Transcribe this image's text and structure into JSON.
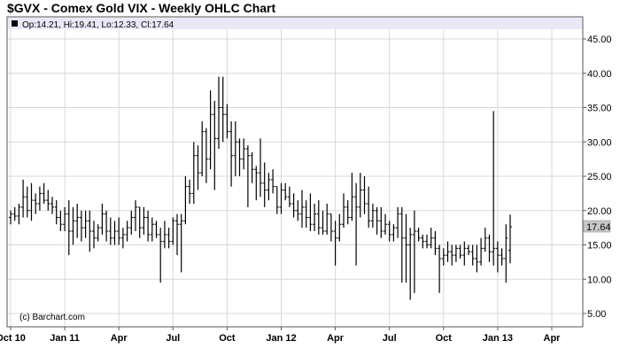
{
  "chart_data": {
    "type": "ohlc",
    "title": "$GVX - Comex Gold VIX - Weekly OHLC Chart",
    "legend": "Op:14.21, Hi:19.41, Lo:12.33, Cl:17.64",
    "credit": "(c) Barchart.com",
    "last_price_label": "17.64",
    "colors": {
      "bar": "#000000",
      "legend_bg": "#e8e8f7",
      "grid": "#d8d8d8",
      "last_price_box": "#c8c8c8"
    },
    "y_ticks": [
      "45.00",
      "40.00",
      "35.00",
      "30.00",
      "25.00",
      "20.00",
      "15.00",
      "10.00",
      "5.00"
    ],
    "ylim": [
      3,
      48
    ],
    "x_ticks": [
      {
        "label": "Oct 10",
        "week": 0
      },
      {
        "label": "Jan 11",
        "week": 13
      },
      {
        "label": "Apr",
        "week": 26
      },
      {
        "label": "Jul",
        "week": 39
      },
      {
        "label": "Oct",
        "week": 52
      },
      {
        "label": "Jan 12",
        "week": 65
      },
      {
        "label": "Apr",
        "week": 78
      },
      {
        "label": "Jul",
        "week": 91
      },
      {
        "label": "Oct",
        "week": 104
      },
      {
        "label": "Jan 13",
        "week": 117
      },
      {
        "label": "Apr",
        "week": 130
      }
    ],
    "bars": [
      [
        19.0,
        20.0,
        18.0,
        19.5
      ],
      [
        19.5,
        20.5,
        18.5,
        19.2
      ],
      [
        19.2,
        21.0,
        18.0,
        20.5
      ],
      [
        20.5,
        24.5,
        19.0,
        22.0
      ],
      [
        22.0,
        23.5,
        19.0,
        20.0
      ],
      [
        20.0,
        24.0,
        18.5,
        21.5
      ],
      [
        21.5,
        22.5,
        19.5,
        21.0
      ],
      [
        21.0,
        23.5,
        20.0,
        22.5
      ],
      [
        22.5,
        24.0,
        21.0,
        21.5
      ],
      [
        21.5,
        23.0,
        20.0,
        21.0
      ],
      [
        21.0,
        22.0,
        19.5,
        20.5
      ],
      [
        20.5,
        21.5,
        18.0,
        19.0
      ],
      [
        19.0,
        20.0,
        17.0,
        18.0
      ],
      [
        18.0,
        20.5,
        17.0,
        19.5
      ],
      [
        19.5,
        21.5,
        13.5,
        17.0
      ],
      [
        17.0,
        20.5,
        15.0,
        18.5
      ],
      [
        18.5,
        21.0,
        16.0,
        19.0
      ],
      [
        19.0,
        20.0,
        15.5,
        17.5
      ],
      [
        17.5,
        20.0,
        16.0,
        18.5
      ],
      [
        18.5,
        20.0,
        14.0,
        17.0
      ],
      [
        17.0,
        18.5,
        14.5,
        16.0
      ],
      [
        16.0,
        18.0,
        15.5,
        17.5
      ],
      [
        17.5,
        21.0,
        16.5,
        19.5
      ],
      [
        19.5,
        20.0,
        15.5,
        17.0
      ],
      [
        17.0,
        19.0,
        15.0,
        16.0
      ],
      [
        16.0,
        18.5,
        15.0,
        17.0
      ],
      [
        17.0,
        19.0,
        15.0,
        16.0
      ],
      [
        16.0,
        17.5,
        14.5,
        16.5
      ],
      [
        16.5,
        18.5,
        15.5,
        17.5
      ],
      [
        17.5,
        20.0,
        16.5,
        19.0
      ],
      [
        19.0,
        21.5,
        17.0,
        20.5
      ],
      [
        20.5,
        20.5,
        16.0,
        17.5
      ],
      [
        17.5,
        20.5,
        16.5,
        19.0
      ],
      [
        19.0,
        20.0,
        15.5,
        16.5
      ],
      [
        16.5,
        19.0,
        15.5,
        18.0
      ],
      [
        18.0,
        18.5,
        16.0,
        16.5
      ],
      [
        16.5,
        17.5,
        9.5,
        15.5
      ],
      [
        15.5,
        18.5,
        14.5,
        16.5
      ],
      [
        16.5,
        17.5,
        14.5,
        15.5
      ],
      [
        15.5,
        19.0,
        15.0,
        18.5
      ],
      [
        18.5,
        19.5,
        13.5,
        18.0
      ],
      [
        18.0,
        19.5,
        11.0,
        18.5
      ],
      [
        18.5,
        25.0,
        18.0,
        23.5
      ],
      [
        23.5,
        24.5,
        21.0,
        22.5
      ],
      [
        22.5,
        30.0,
        21.0,
        28.0
      ],
      [
        28.0,
        29.5,
        23.0,
        25.5
      ],
      [
        25.5,
        33.0,
        25.0,
        31.5
      ],
      [
        31.5,
        32.0,
        24.0,
        27.5
      ],
      [
        27.5,
        37.5,
        26.0,
        34.0
      ],
      [
        34.0,
        36.0,
        23.0,
        30.5
      ],
      [
        30.5,
        39.5,
        29.0,
        35.0
      ],
      [
        35.0,
        39.5,
        30.0,
        34.0
      ],
      [
        34.0,
        35.5,
        30.5,
        31.5
      ],
      [
        31.5,
        33.0,
        23.5,
        28.0
      ],
      [
        28.0,
        33.0,
        25.0,
        30.0
      ],
      [
        30.0,
        30.5,
        25.0,
        27.5
      ],
      [
        27.5,
        30.5,
        26.0,
        29.0
      ],
      [
        29.0,
        29.5,
        20.5,
        28.0
      ],
      [
        28.0,
        28.5,
        24.0,
        26.0
      ],
      [
        26.0,
        26.5,
        21.5,
        25.5
      ],
      [
        25.5,
        30.5,
        22.0,
        24.0
      ],
      [
        24.0,
        27.0,
        20.5,
        23.0
      ],
      [
        23.0,
        25.5,
        21.5,
        24.5
      ],
      [
        24.5,
        26.0,
        22.5,
        23.5
      ],
      [
        23.5,
        23.5,
        19.5,
        20.5
      ],
      [
        20.5,
        24.0,
        19.5,
        23.0
      ],
      [
        23.0,
        24.0,
        21.5,
        22.0
      ],
      [
        22.0,
        23.5,
        20.5,
        21.0
      ],
      [
        21.0,
        22.5,
        19.0,
        20.0
      ],
      [
        20.0,
        21.5,
        18.5,
        19.5
      ],
      [
        19.5,
        23.0,
        17.5,
        20.5
      ],
      [
        20.5,
        21.5,
        17.5,
        19.0
      ],
      [
        19.0,
        22.5,
        17.0,
        18.0
      ],
      [
        18.0,
        21.0,
        17.0,
        19.5
      ],
      [
        19.5,
        21.5,
        16.5,
        17.5
      ],
      [
        17.5,
        20.0,
        16.5,
        17.0
      ],
      [
        17.0,
        21.0,
        16.5,
        19.5
      ],
      [
        19.5,
        19.5,
        15.5,
        17.0
      ],
      [
        17.0,
        18.5,
        12.0,
        16.0
      ],
      [
        16.0,
        19.5,
        15.5,
        18.0
      ],
      [
        18.0,
        22.5,
        17.5,
        20.5
      ],
      [
        20.5,
        21.5,
        18.0,
        19.0
      ],
      [
        19.0,
        25.5,
        18.5,
        22.0
      ],
      [
        22.0,
        24.0,
        12.0,
        20.5
      ],
      [
        20.5,
        25.5,
        19.0,
        23.0
      ],
      [
        23.0,
        25.0,
        19.5,
        21.0
      ],
      [
        21.0,
        23.5,
        17.5,
        18.5
      ],
      [
        18.5,
        21.0,
        17.5,
        20.0
      ],
      [
        20.0,
        20.5,
        16.5,
        18.5
      ],
      [
        18.5,
        20.5,
        16.0,
        17.0
      ],
      [
        17.0,
        19.5,
        16.5,
        18.0
      ],
      [
        18.0,
        18.5,
        15.5,
        16.5
      ],
      [
        16.5,
        18.0,
        15.5,
        17.5
      ],
      [
        17.5,
        20.5,
        16.0,
        19.5
      ],
      [
        19.5,
        20.5,
        9.5,
        16.0
      ],
      [
        16.0,
        19.5,
        9.5,
        15.0
      ],
      [
        15.0,
        17.5,
        7.0,
        16.5
      ],
      [
        16.5,
        20.0,
        8.0,
        17.0
      ],
      [
        17.0,
        17.5,
        15.5,
        16.0
      ],
      [
        16.0,
        16.5,
        14.5,
        15.5
      ],
      [
        15.5,
        16.5,
        14.5,
        15.0
      ],
      [
        15.0,
        17.5,
        14.5,
        16.0
      ],
      [
        16.0,
        17.0,
        13.5,
        14.5
      ],
      [
        14.5,
        15.0,
        8.0,
        13.0
      ],
      [
        13.0,
        14.5,
        12.0,
        13.5
      ],
      [
        13.5,
        15.5,
        12.5,
        14.0
      ],
      [
        14.0,
        15.0,
        12.0,
        13.5
      ],
      [
        13.5,
        15.0,
        12.5,
        14.5
      ],
      [
        14.5,
        15.0,
        13.0,
        13.5
      ],
      [
        13.5,
        15.5,
        12.0,
        14.5
      ],
      [
        14.5,
        15.0,
        13.5,
        14.0
      ],
      [
        14.0,
        15.0,
        12.0,
        13.0
      ],
      [
        13.0,
        15.0,
        11.0,
        12.5
      ],
      [
        12.5,
        16.0,
        12.0,
        14.5
      ],
      [
        14.5,
        17.5,
        14.0,
        16.0
      ],
      [
        16.0,
        16.5,
        12.5,
        14.0
      ],
      [
        14.0,
        34.5,
        12.0,
        14.5
      ],
      [
        14.5,
        15.5,
        11.0,
        13.5
      ],
      [
        13.5,
        14.5,
        12.0,
        13.0
      ],
      [
        13.0,
        18.0,
        9.5,
        16.0
      ],
      [
        14.21,
        19.41,
        12.33,
        17.64
      ]
    ]
  }
}
